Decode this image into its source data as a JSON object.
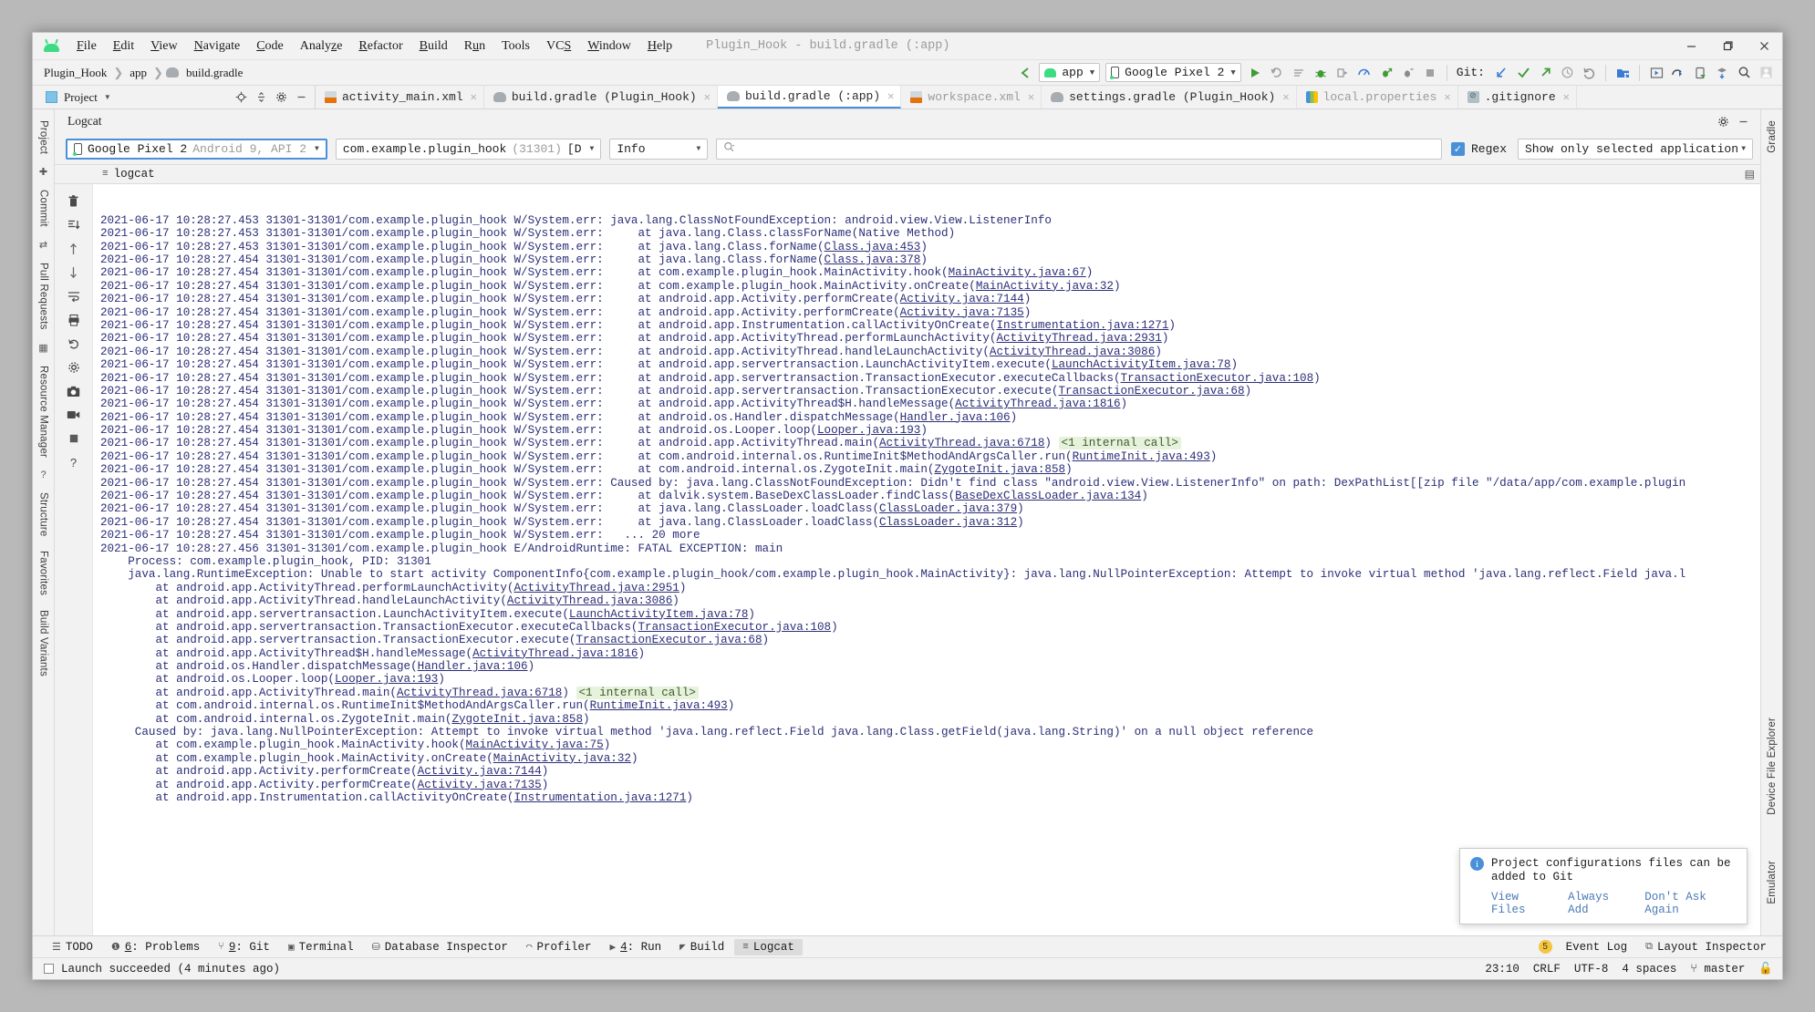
{
  "window": {
    "title": "Plugin_Hook - build.gradle (:app)",
    "logo": "android-logo-icon",
    "minimize": "minimize-icon",
    "maximize": "maximize-icon",
    "close": "close-icon"
  },
  "menubar": {
    "items": [
      "File",
      "Edit",
      "View",
      "Navigate",
      "Code",
      "Analyze",
      "Refactor",
      "Build",
      "Run",
      "Tools",
      "VCS",
      "Window",
      "Help"
    ]
  },
  "breadcrumb": {
    "items": [
      "Plugin_Hook",
      "app",
      "build.gradle"
    ]
  },
  "run_toolbar": {
    "module_config": "app",
    "device": "Google Pixel 2",
    "git_label": "Git:",
    "icons": [
      "back-arrow-icon",
      "run-icon",
      "rerun-icon",
      "select-run-config-icon",
      "debug-icon",
      "attach-debugger-icon",
      "profiler-icon",
      "apply-changes-icon",
      "apply-code-changes-icon",
      "stop-icon",
      "update-project-icon",
      "commit-icon",
      "push-icon",
      "history-icon",
      "rollback-icon",
      "open-folder-icon",
      "layout-inspector-icon",
      "device-manager-icon",
      "device-file-explorer-icon",
      "sdk-manager-icon",
      "search-everywhere-icon",
      "avatar-icon"
    ]
  },
  "project_panel": {
    "label": "Project",
    "icons": [
      "locate-icon",
      "collapse-all-icon",
      "settings-icon",
      "hide-icon"
    ]
  },
  "editor_tabs": [
    {
      "label": "activity_main.xml",
      "icon": "xml-layout-icon",
      "active": false,
      "dim": false
    },
    {
      "label": "build.gradle (Plugin_Hook)",
      "icon": "gradle-icon",
      "active": false,
      "dim": false
    },
    {
      "label": "build.gradle (:app)",
      "icon": "gradle-icon",
      "active": true,
      "dim": false
    },
    {
      "label": "workspace.xml",
      "icon": "xml-icon",
      "active": false,
      "dim": true
    },
    {
      "label": "settings.gradle (Plugin_Hook)",
      "icon": "gradle-icon",
      "active": false,
      "dim": false
    },
    {
      "label": "local.properties",
      "icon": "properties-icon",
      "active": false,
      "dim": true
    },
    {
      "label": ".gitignore",
      "icon": "gitignore-icon",
      "active": false,
      "dim": false
    }
  ],
  "left_strip": {
    "items": [
      "Project",
      "Commit",
      "Pull Requests",
      "Resource Manager",
      "Structure",
      "Favorites",
      "Build Variants"
    ]
  },
  "right_strip": {
    "items": [
      "Gradle",
      "Device File Explorer",
      "Emulator"
    ]
  },
  "logcat_panel": {
    "title": "Logcat",
    "device_selector": {
      "name": "Google Pixel 2",
      "detail": "Android 9, API 2"
    },
    "process_selector": {
      "name": "com.example.plugin_hook",
      "pid": "(31301)",
      "suffix": "[D"
    },
    "level_selector": "Info",
    "search_placeholder": "",
    "regex_label": "Regex",
    "regex_checked": true,
    "filter_selector": "Show only selected application",
    "tab_label": "logcat"
  },
  "console": {
    "lines": [
      "2021-06-17 10:28:27.453 31301-31301/com.example.plugin_hook W/System.err: java.lang.ClassNotFoundException: android.view.View.ListenerInfo",
      "2021-06-17 10:28:27.453 31301-31301/com.example.plugin_hook W/System.err:     at java.lang.Class.classForName(Native Method)",
      "2021-06-17 10:28:27.453 31301-31301/com.example.plugin_hook W/System.err:     at java.lang.Class.forName(Class.java:453)",
      "2021-06-17 10:28:27.454 31301-31301/com.example.plugin_hook W/System.err:     at java.lang.Class.forName(Class.java:378)",
      "2021-06-17 10:28:27.454 31301-31301/com.example.plugin_hook W/System.err:     at com.example.plugin_hook.MainActivity.hook(MainActivity.java:67)",
      "2021-06-17 10:28:27.454 31301-31301/com.example.plugin_hook W/System.err:     at com.example.plugin_hook.MainActivity.onCreate(MainActivity.java:32)",
      "2021-06-17 10:28:27.454 31301-31301/com.example.plugin_hook W/System.err:     at android.app.Activity.performCreate(Activity.java:7144)",
      "2021-06-17 10:28:27.454 31301-31301/com.example.plugin_hook W/System.err:     at android.app.Activity.performCreate(Activity.java:7135)",
      "2021-06-17 10:28:27.454 31301-31301/com.example.plugin_hook W/System.err:     at android.app.Instrumentation.callActivityOnCreate(Instrumentation.java:1271)",
      "2021-06-17 10:28:27.454 31301-31301/com.example.plugin_hook W/System.err:     at android.app.ActivityThread.performLaunchActivity(ActivityThread.java:2931)",
      "2021-06-17 10:28:27.454 31301-31301/com.example.plugin_hook W/System.err:     at android.app.ActivityThread.handleLaunchActivity(ActivityThread.java:3086)",
      "2021-06-17 10:28:27.454 31301-31301/com.example.plugin_hook W/System.err:     at android.app.servertransaction.LaunchActivityItem.execute(LaunchActivityItem.java:78)",
      "2021-06-17 10:28:27.454 31301-31301/com.example.plugin_hook W/System.err:     at android.app.servertransaction.TransactionExecutor.executeCallbacks(TransactionExecutor.java:108)",
      "2021-06-17 10:28:27.454 31301-31301/com.example.plugin_hook W/System.err:     at android.app.servertransaction.TransactionExecutor.execute(TransactionExecutor.java:68)",
      "2021-06-17 10:28:27.454 31301-31301/com.example.plugin_hook W/System.err:     at android.app.ActivityThread$H.handleMessage(ActivityThread.java:1816)",
      "2021-06-17 10:28:27.454 31301-31301/com.example.plugin_hook W/System.err:     at android.os.Handler.dispatchMessage(Handler.java:106)",
      "2021-06-17 10:28:27.454 31301-31301/com.example.plugin_hook W/System.err:     at android.os.Looper.loop(Looper.java:193)",
      "2021-06-17 10:28:27.454 31301-31301/com.example.plugin_hook W/System.err:     at android.app.ActivityThread.main(ActivityThread.java:6718) <1 internal call>",
      "2021-06-17 10:28:27.454 31301-31301/com.example.plugin_hook W/System.err:     at com.android.internal.os.RuntimeInit$MethodAndArgsCaller.run(RuntimeInit.java:493)",
      "2021-06-17 10:28:27.454 31301-31301/com.example.plugin_hook W/System.err:     at com.android.internal.os.ZygoteInit.main(ZygoteInit.java:858)",
      "2021-06-17 10:28:27.454 31301-31301/com.example.plugin_hook W/System.err: Caused by: java.lang.ClassNotFoundException: Didn't find class \"android.view.View.ListenerInfo\" on path: DexPathList[[zip file \"/data/app/com.example.plugin",
      "2021-06-17 10:28:27.454 31301-31301/com.example.plugin_hook W/System.err:     at dalvik.system.BaseDexClassLoader.findClass(BaseDexClassLoader.java:134)",
      "2021-06-17 10:28:27.454 31301-31301/com.example.plugin_hook W/System.err:     at java.lang.ClassLoader.loadClass(ClassLoader.java:379)",
      "2021-06-17 10:28:27.454 31301-31301/com.example.plugin_hook W/System.err:     at java.lang.ClassLoader.loadClass(ClassLoader.java:312)",
      "2021-06-17 10:28:27.454 31301-31301/com.example.plugin_hook W/System.err:   ... 20 more",
      "2021-06-17 10:28:27.456 31301-31301/com.example.plugin_hook E/AndroidRuntime: FATAL EXCEPTION: main",
      "    Process: com.example.plugin_hook, PID: 31301",
      "    java.lang.RuntimeException: Unable to start activity ComponentInfo{com.example.plugin_hook/com.example.plugin_hook.MainActivity}: java.lang.NullPointerException: Attempt to invoke virtual method 'java.lang.reflect.Field java.l",
      "        at android.app.ActivityThread.performLaunchActivity(ActivityThread.java:2951)",
      "        at android.app.ActivityThread.handleLaunchActivity(ActivityThread.java:3086)",
      "        at android.app.servertransaction.LaunchActivityItem.execute(LaunchActivityItem.java:78)",
      "        at android.app.servertransaction.TransactionExecutor.executeCallbacks(TransactionExecutor.java:108)",
      "        at android.app.servertransaction.TransactionExecutor.execute(TransactionExecutor.java:68)",
      "        at android.app.ActivityThread$H.handleMessage(ActivityThread.java:1816)",
      "        at android.os.Handler.dispatchMessage(Handler.java:106)",
      "        at android.os.Looper.loop(Looper.java:193)",
      "        at android.app.ActivityThread.main(ActivityThread.java:6718) <1 internal call>",
      "        at com.android.internal.os.RuntimeInit$MethodAndArgsCaller.run(RuntimeInit.java:493)",
      "        at com.android.internal.os.ZygoteInit.main(ZygoteInit.java:858)",
      "     Caused by: java.lang.NullPointerException: Attempt to invoke virtual method 'java.lang.reflect.Field java.lang.Class.getField(java.lang.String)' on a null object reference",
      "        at com.example.plugin_hook.MainActivity.hook(MainActivity.java:75)",
      "        at com.example.plugin_hook.MainActivity.onCreate(MainActivity.java:32)",
      "        at android.app.Activity.performCreate(Activity.java:7144)",
      "        at android.app.Activity.performCreate(Activity.java:7135)",
      "        at android.app.Instrumentation.callActivityOnCreate(Instrumentation.java:1271)"
    ],
    "gutter_icons": [
      "clear-logcat-icon",
      "scroll-to-end-icon",
      "up-arrow-icon",
      "down-arrow-icon",
      "soft-wrap-icon",
      "print-icon",
      "restart-icon",
      "settings-icon",
      "screenshot-icon",
      "screen-record-icon",
      "stop-icon",
      "help-icon"
    ]
  },
  "notification": {
    "title": "Project configurations files can be added to Git",
    "icon": "info-icon",
    "actions": [
      "View Files",
      "Always Add",
      "Don't Ask Again"
    ]
  },
  "tool_windows": {
    "left": [
      {
        "label": "TODO",
        "icon": "todo-icon",
        "mnemonic": "",
        "active": false
      },
      {
        "label": ": Problems",
        "icon": "problems-icon",
        "mnemonic": "6",
        "active": false
      },
      {
        "label": ": Git",
        "icon": "git-icon",
        "mnemonic": "9",
        "active": false
      },
      {
        "label": "Terminal",
        "icon": "terminal-icon",
        "mnemonic": "",
        "active": false
      },
      {
        "label": "Database Inspector",
        "icon": "database-icon",
        "mnemonic": "",
        "active": false
      },
      {
        "label": "Profiler",
        "icon": "profiler-icon",
        "mnemonic": "",
        "active": false
      },
      {
        "label": ": Run",
        "icon": "run-icon",
        "mnemonic": "4",
        "active": false
      },
      {
        "label": "Build",
        "icon": "build-icon",
        "mnemonic": "",
        "active": false
      },
      {
        "label": "Logcat",
        "icon": "logcat-icon",
        "mnemonic": "",
        "active": true
      }
    ],
    "right": [
      {
        "label": "Event Log",
        "icon": "event-log-icon",
        "count": "5"
      },
      {
        "label": "Layout Inspector",
        "icon": "layout-inspector-icon",
        "count": ""
      }
    ]
  },
  "statusbar": {
    "message": "Launch succeeded (4 minutes ago)",
    "position": "23:10",
    "line_ending": "CRLF",
    "encoding": "UTF-8",
    "indent": "4 spaces",
    "branch": "master",
    "lock": "lock-icon"
  },
  "colors": {
    "accent": "#4a90d9",
    "android_green": "#3ddc84",
    "console_text": "#2b2f77",
    "badge_bg": "#e7f2dc",
    "chrome": "#f2f2f2"
  }
}
